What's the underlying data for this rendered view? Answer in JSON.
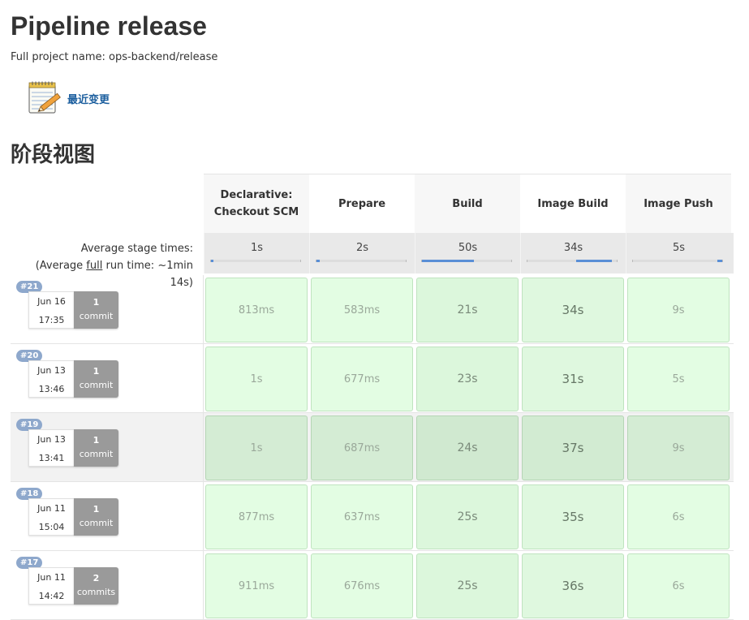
{
  "page": {
    "title": "Pipeline release",
    "full_project_name": "Full project name: ops-backend/release"
  },
  "links": {
    "recent_changes": "最近变更",
    "recent_changes_icon": "notepad-icon"
  },
  "stage_view": {
    "title": "阶段视图",
    "avg_label_line1": "Average stage times:",
    "avg_label_prefix": "(Average ",
    "avg_label_full": "full",
    "avg_label_suffix": " run time: ~1min 14s)",
    "stages": [
      {
        "name_line1": "Declarative:",
        "name_line2": "Checkout SCM",
        "avg": "1s",
        "avg_fraction": 0.02
      },
      {
        "name_line1": "Prepare",
        "name_line2": "",
        "avg": "2s",
        "avg_fraction": 0.04
      },
      {
        "name_line1": "Build",
        "name_line2": "",
        "avg": "50s",
        "avg_fraction": 0.58
      },
      {
        "name_line1": "Image Build",
        "name_line2": "",
        "avg": "34s",
        "avg_fraction": 0.39
      },
      {
        "name_line1": "Image Push",
        "name_line2": "",
        "avg": "5s",
        "avg_fraction": 0.05
      }
    ],
    "runs": [
      {
        "id": "#21",
        "date": "Jun 16",
        "time": "17:35",
        "commits_n": "1",
        "commits_word": "commit",
        "times": [
          "813ms",
          "583ms",
          "21s",
          "34s",
          "9s"
        ],
        "highlight": false
      },
      {
        "id": "#20",
        "date": "Jun 13",
        "time": "13:46",
        "commits_n": "1",
        "commits_word": "commit",
        "times": [
          "1s",
          "677ms",
          "23s",
          "31s",
          "5s"
        ],
        "highlight": false
      },
      {
        "id": "#19",
        "date": "Jun 13",
        "time": "13:41",
        "commits_n": "1",
        "commits_word": "commit",
        "times": [
          "1s",
          "687ms",
          "24s",
          "37s",
          "9s"
        ],
        "highlight": true
      },
      {
        "id": "#18",
        "date": "Jun 11",
        "time": "15:04",
        "commits_n": "1",
        "commits_word": "commit",
        "times": [
          "877ms",
          "637ms",
          "25s",
          "35s",
          "6s"
        ],
        "highlight": false
      },
      {
        "id": "#17",
        "date": "Jun 11",
        "time": "14:42",
        "commits_n": "2",
        "commits_word": "commits",
        "times": [
          "911ms",
          "676ms",
          "25s",
          "36s",
          "6s"
        ],
        "highlight": false
      }
    ]
  },
  "colors": {
    "link": "#1b5e9e",
    "success_cell": "#e3fde3",
    "badge": "#8ea8cc",
    "progress": "#5a8fd6"
  }
}
